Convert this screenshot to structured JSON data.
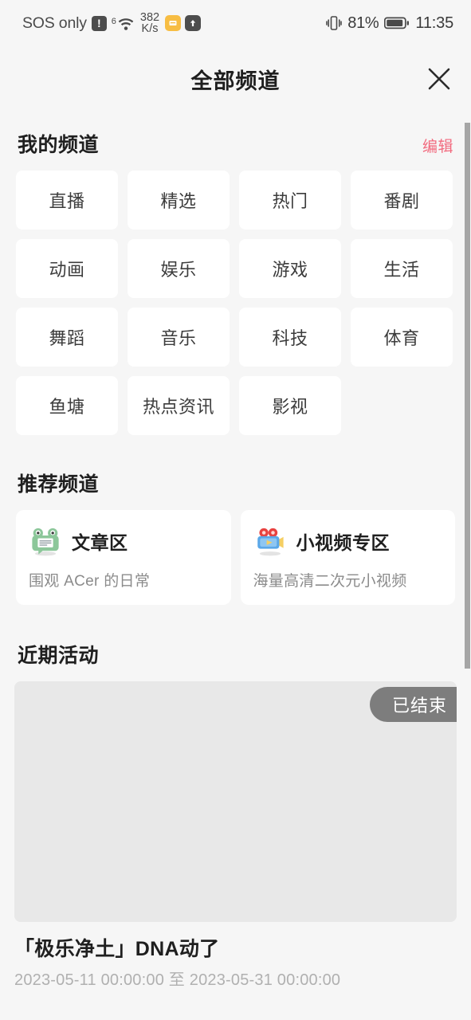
{
  "status_bar": {
    "carrier": "SOS only",
    "warning_icon": "warning-exclamation-icon",
    "wifi_generation": "6",
    "wifi_icon": "wifi-icon",
    "net_speed_value": "382",
    "net_speed_unit": "K/s",
    "app_badge_1": "yellow-app-icon",
    "app_badge_2": "upload-arrow-icon",
    "vibrate_icon": "vibrate-icon",
    "battery_percent": "81%",
    "battery_icon": "battery-icon",
    "time": "11:35"
  },
  "header": {
    "title": "全部频道",
    "close_icon": "close-icon"
  },
  "my_channels": {
    "section_title": "我的频道",
    "edit_label": "编辑",
    "tiles": [
      "直播",
      "精选",
      "热门",
      "番剧",
      "动画",
      "娱乐",
      "游戏",
      "生活",
      "舞蹈",
      "音乐",
      "科技",
      "体育",
      "鱼塘",
      "热点资讯",
      "影视"
    ]
  },
  "recommended": {
    "section_title": "推荐频道",
    "cards": [
      {
        "icon": "frog-article-icon",
        "title": "文章区",
        "subtitle": "围观 ACer 的日常"
      },
      {
        "icon": "movie-camera-icon",
        "title": "小视频专区",
        "subtitle": "海量高清二次元小视频"
      }
    ]
  },
  "recent_activity": {
    "section_title": "近期活动",
    "badge": "已结束",
    "title": "「极乐净土」DNA动了",
    "date_range": "2023-05-11 00:00:00 至 2023-05-31 00:00:00"
  },
  "colors": {
    "background": "#f6f6f6",
    "tile": "#ffffff",
    "edit_accent": "#f26a7e",
    "badge_gray": "#7d7d7d",
    "placeholder_gray": "#e8e8e8"
  }
}
